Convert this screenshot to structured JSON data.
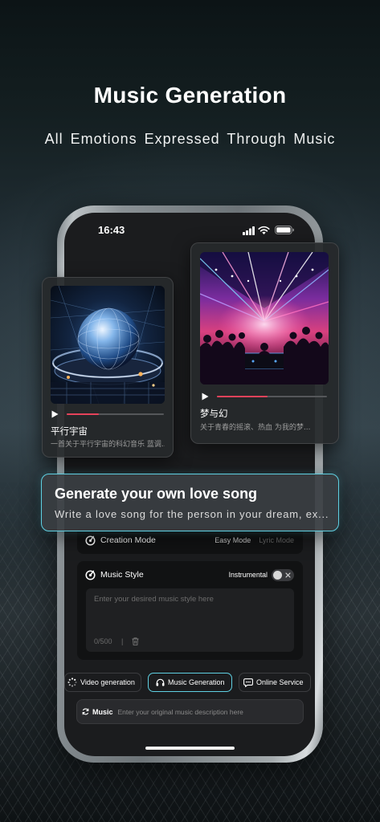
{
  "header": {
    "title": "Music Generation",
    "subtitle": "All Emotions Expressed Through Music"
  },
  "status_bar": {
    "time": "16:43",
    "icons": [
      "signal-icon",
      "wifi-icon",
      "battery-icon"
    ]
  },
  "cards": [
    {
      "title": "平行宇宙",
      "description": "一首关于平行宇宙的科幻音乐 蓝调...",
      "progress": 0.33
    },
    {
      "title": "梦与幻",
      "description": "关于青春的摇滚、热血 为我的梦...",
      "progress": 0.46
    }
  ],
  "banner": {
    "title": "Generate your own love song",
    "text": "Write a love song for the person in your dream, ex..."
  },
  "creation_mode": {
    "icon": "music-disc-icon",
    "label": "Creation Mode",
    "options": [
      "Easy Mode",
      "Lyric Mode"
    ],
    "selected_index": 0
  },
  "music_style": {
    "icon": "music-disc-icon",
    "label": "Music Style",
    "toggle_label": "Instrumental",
    "toggle_on": false,
    "placeholder": "Enter your desired music style here",
    "counter": "0/500",
    "divider": "|"
  },
  "tabs": [
    {
      "label": "Video generation",
      "icon": "spinner-icon",
      "active": false
    },
    {
      "label": "Music Generation",
      "icon": "headphones-icon",
      "active": true
    },
    {
      "label": "Online Service",
      "icon": "chat-icon",
      "active": false
    }
  ],
  "composer": {
    "mode_icon": "refresh-icon",
    "mode_label": "Music",
    "placeholder": "Enter your original music description here"
  },
  "colors": {
    "accent": "#5fd0e2",
    "progress": "#e5425a"
  }
}
